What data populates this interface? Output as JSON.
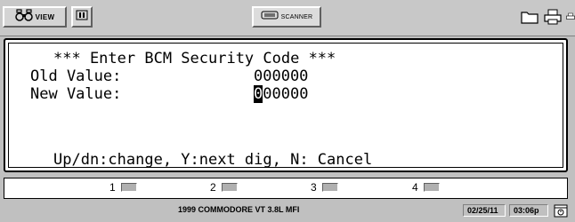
{
  "toolbar": {
    "view_label": "VIEW",
    "scanner_label": "SCANNER"
  },
  "screen": {
    "title": "*** Enter BCM Security Code ***",
    "old_label": "Old Value:",
    "old_value": "000000",
    "new_label": "New Value:",
    "new_value_cursor": "0",
    "new_value_rest": "00000",
    "help": "Up/dn:change, Y:next dig, N: Cancel"
  },
  "function_keys": [
    "1",
    "2",
    "3",
    "4"
  ],
  "status": {
    "vehicle": "1999 COMMODORE VT 3.8L MFI",
    "date": "02/25/11",
    "time": "03:06p"
  }
}
